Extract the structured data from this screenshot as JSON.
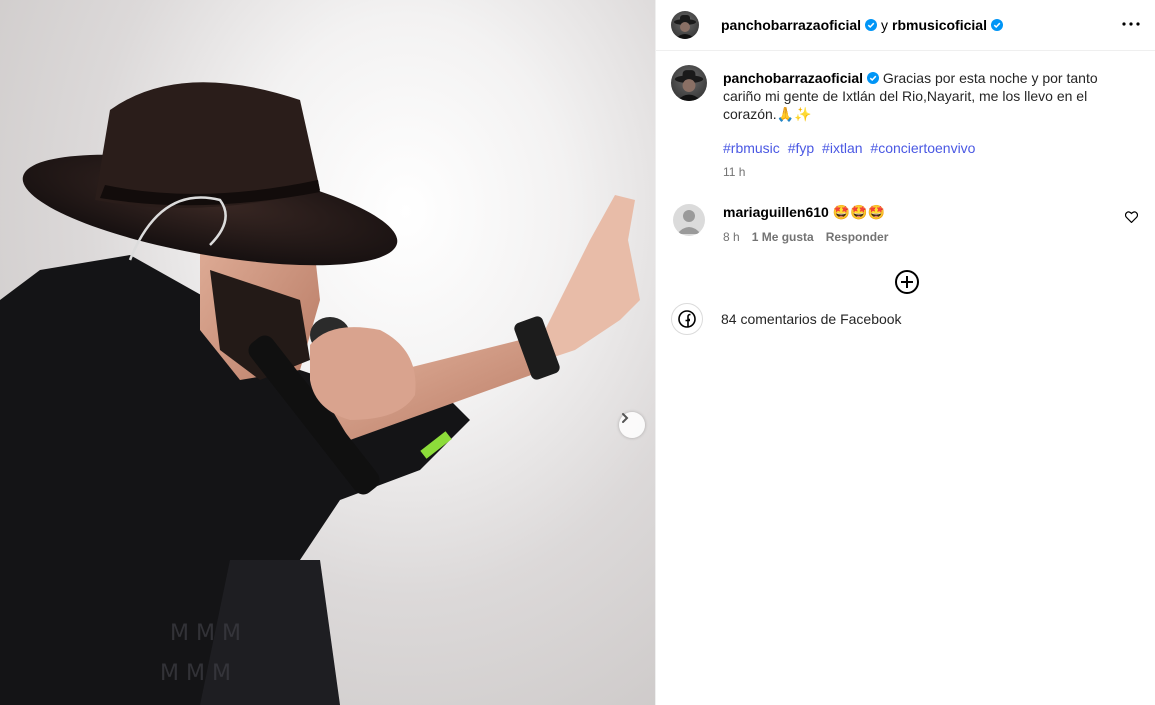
{
  "post": {
    "author": "panchobarrazaoficial",
    "conjunction": "y",
    "coauthor": "rbmusicoficial",
    "caption_user": "panchobarrazaoficial",
    "caption_text": "Gracias por esta noche y por tanto cariño mi gente de Ixtlán del Rio,Nayarit, me los llevo en el corazón.🙏✨",
    "hashtags": [
      "#rbmusic",
      "#fyp",
      "#ixtlan",
      "#conciertoenvivo"
    ],
    "time": "11 h"
  },
  "comment": {
    "user": "mariaguillen610",
    "text": "🤩🤩🤩",
    "time": "8 h",
    "likes": "1 Me gusta",
    "reply": "Responder"
  },
  "facebook": {
    "label": "84 comentarios de Facebook"
  },
  "colors": {
    "verified": "#0095f6",
    "hashtag": "#4a58e3",
    "muted": "#737373"
  }
}
